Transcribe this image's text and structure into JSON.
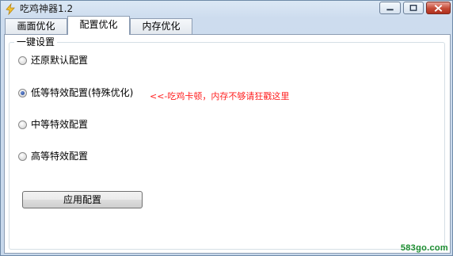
{
  "window": {
    "title": "吃鸡神器1.2",
    "icon": "lightning-app-icon"
  },
  "tabs": [
    {
      "label": "画面优化",
      "active": false
    },
    {
      "label": "配置优化",
      "active": true
    },
    {
      "label": "内存优化",
      "active": false
    }
  ],
  "group": {
    "legend": "一键设置",
    "options": [
      {
        "label": "还原默认配置",
        "checked": false
      },
      {
        "label": "低等特效配置(特殊优化)",
        "checked": true
      },
      {
        "label": "中等特效配置",
        "checked": false
      },
      {
        "label": "高等特效配置",
        "checked": false
      }
    ],
    "hint": "<<-吃鸡卡顿，内存不够请狂戳这里",
    "apply_button": "应用配置"
  },
  "watermark": "583go.com",
  "colors": {
    "hint": "#ff2020",
    "watermark": "#1a8c2e",
    "close_button": "#c44a36"
  }
}
